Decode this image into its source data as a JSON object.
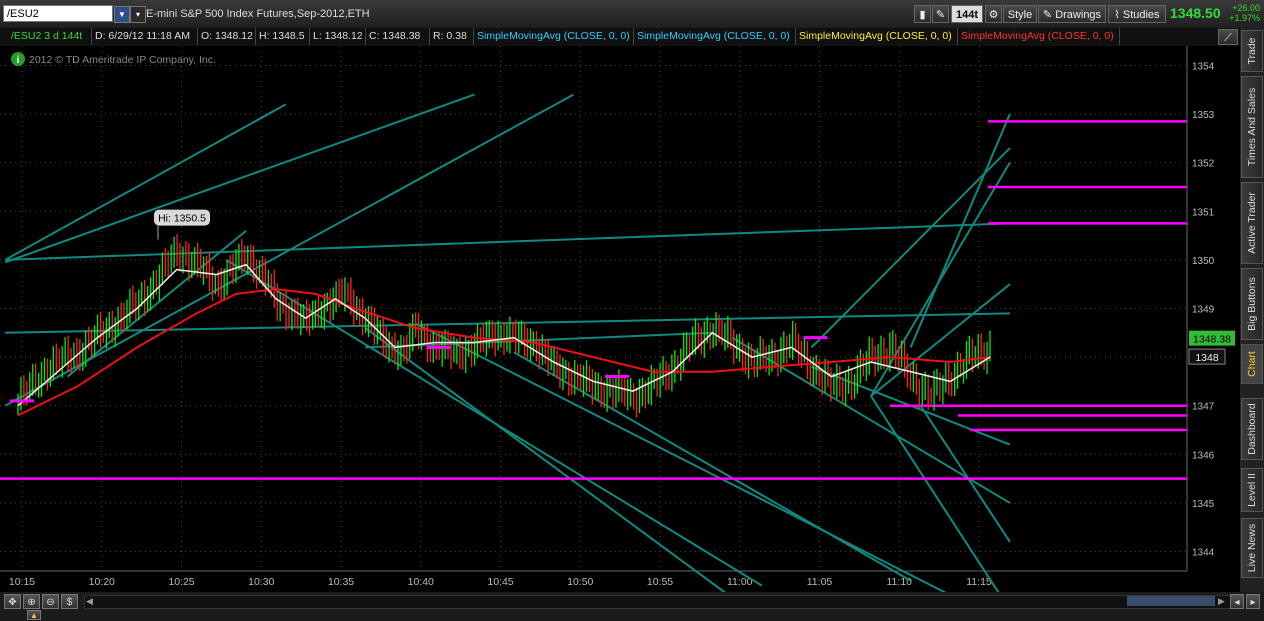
{
  "window": {
    "symbol": "/ESU2",
    "description": "E-mini S&P 500 Index Futures,Sep-2012,ETH",
    "last_price": "1348.50",
    "net_change": "+26.00",
    "pct_change": "+1.97%",
    "tick_aggregation": "144t",
    "buttons": {
      "style": "Style",
      "drawings": "Drawings",
      "studies": "Studies"
    }
  },
  "infobar": {
    "chart_label": "/ESU2 3 d 144t",
    "date_time": "D: 6/29/12 11:18 AM",
    "open": "O: 1348.12",
    "high": "H: 1348.5",
    "low": "L: 1348.12",
    "close": "C: 1348.38",
    "range": "R: 0.38",
    "studies": [
      {
        "label": "SimpleMovingAvg (CLOSE, 0, 0)",
        "color": "#33ccff"
      },
      {
        "label": "SimpleMovingAvg (CLOSE, 0, 0)",
        "color": "#33ccff"
      },
      {
        "label": "SimpleMovingAvg (CLOSE, 0, 0)",
        "color": "#ffee33"
      },
      {
        "label": "SimpleMovingAvg (CLOSE, 0, 0)",
        "color": "#ff3333"
      }
    ]
  },
  "copyright": "2012 © TD Ameritrade IP Company, Inc.",
  "right_tabs": [
    "Trade",
    "Times And Sales",
    "Active Trader",
    "Big Buttons",
    "Chart",
    "Dashboard",
    "Level II",
    "Live News"
  ],
  "active_tab": "Chart",
  "colors": {
    "background": "#000000",
    "grid": "#444444",
    "trendline": "#108a80",
    "level_line": "#ff00ff",
    "bar_up": "#00ee00",
    "bar_down": "#ff2222",
    "sma_fast": "#e8e8e8",
    "sma_slow": "#ee1111",
    "price_badge": "#33bb33"
  },
  "chart_data": {
    "type": "candlestick-tick",
    "ylim": [
      1343.6,
      1354.4
    ],
    "y_ticks": [
      1344,
      1345,
      1346,
      1347,
      1348,
      1349,
      1350,
      1351,
      1352,
      1353,
      1354
    ],
    "x_ticks": [
      "10:15",
      "10:20",
      "10:25",
      "10:30",
      "10:35",
      "10:40",
      "10:45",
      "10:50",
      "10:55",
      "11:00",
      "11:05",
      "11:10",
      "11:15"
    ],
    "high_bubble": "Hi: 1350.5",
    "price_tags": [
      "1348.38",
      "1348"
    ],
    "horizontal_levels": [
      1345.5,
      1346.5,
      1346.8,
      1347.0,
      1350.75,
      1351.5,
      1352.85
    ],
    "close_series": [
      [
        0,
        1347.1
      ],
      [
        3,
        1347.8
      ],
      [
        6,
        1348.1
      ],
      [
        9,
        1348.6
      ],
      [
        12,
        1349.1
      ],
      [
        14,
        1349.6
      ],
      [
        16,
        1350.2
      ],
      [
        18,
        1349.9
      ],
      [
        20,
        1349.5
      ],
      [
        21,
        1349.7
      ],
      [
        23,
        1350.1
      ],
      [
        25,
        1349.6
      ],
      [
        26,
        1349.1
      ],
      [
        28,
        1348.9
      ],
      [
        29,
        1348.7
      ],
      [
        31,
        1349.1
      ],
      [
        33,
        1349.3
      ],
      [
        35,
        1348.8
      ],
      [
        37,
        1348.3
      ],
      [
        39,
        1348.1
      ],
      [
        40,
        1348.6
      ],
      [
        42,
        1348.2
      ],
      [
        44,
        1348.1
      ],
      [
        46,
        1348.2
      ],
      [
        48,
        1348.5
      ],
      [
        50,
        1348.4
      ],
      [
        52,
        1348.3
      ],
      [
        54,
        1347.8
      ],
      [
        56,
        1347.6
      ],
      [
        58,
        1347.4
      ],
      [
        60,
        1347.3
      ],
      [
        62,
        1347.2
      ],
      [
        64,
        1347.4
      ],
      [
        66,
        1347.8
      ],
      [
        68,
        1348.3
      ],
      [
        70,
        1348.6
      ],
      [
        72,
        1348.3
      ],
      [
        74,
        1347.9
      ],
      [
        76,
        1348.0
      ],
      [
        78,
        1348.3
      ],
      [
        80,
        1347.8
      ],
      [
        82,
        1347.4
      ],
      [
        84,
        1347.5
      ],
      [
        86,
        1348.0
      ],
      [
        88,
        1348.2
      ],
      [
        90,
        1347.6
      ],
      [
        92,
        1347.2
      ],
      [
        94,
        1347.6
      ],
      [
        96,
        1348.0
      ],
      [
        98,
        1348.2
      ]
    ],
    "sma_fast": [
      [
        0,
        1347.0
      ],
      [
        4,
        1347.7
      ],
      [
        8,
        1348.4
      ],
      [
        12,
        1349.0
      ],
      [
        16,
        1349.8
      ],
      [
        20,
        1349.7
      ],
      [
        23,
        1349.9
      ],
      [
        26,
        1349.2
      ],
      [
        29,
        1348.8
      ],
      [
        32,
        1349.2
      ],
      [
        35,
        1348.8
      ],
      [
        38,
        1348.2
      ],
      [
        42,
        1348.3
      ],
      [
        46,
        1348.3
      ],
      [
        50,
        1348.4
      ],
      [
        54,
        1347.9
      ],
      [
        58,
        1347.5
      ],
      [
        62,
        1347.3
      ],
      [
        66,
        1347.7
      ],
      [
        70,
        1348.5
      ],
      [
        74,
        1348.0
      ],
      [
        78,
        1348.2
      ],
      [
        82,
        1347.6
      ],
      [
        86,
        1347.9
      ],
      [
        90,
        1347.7
      ],
      [
        94,
        1347.5
      ],
      [
        98,
        1348.0
      ]
    ],
    "sma_slow": [
      [
        0,
        1346.8
      ],
      [
        6,
        1347.4
      ],
      [
        12,
        1348.2
      ],
      [
        18,
        1348.9
      ],
      [
        22,
        1349.3
      ],
      [
        26,
        1349.4
      ],
      [
        30,
        1349.3
      ],
      [
        34,
        1349.0
      ],
      [
        40,
        1348.6
      ],
      [
        46,
        1348.4
      ],
      [
        52,
        1348.3
      ],
      [
        58,
        1348.0
      ],
      [
        64,
        1347.7
      ],
      [
        70,
        1347.7
      ],
      [
        76,
        1347.8
      ],
      [
        82,
        1347.9
      ],
      [
        88,
        1348.0
      ],
      [
        94,
        1347.9
      ],
      [
        98,
        1348.0
      ]
    ]
  }
}
